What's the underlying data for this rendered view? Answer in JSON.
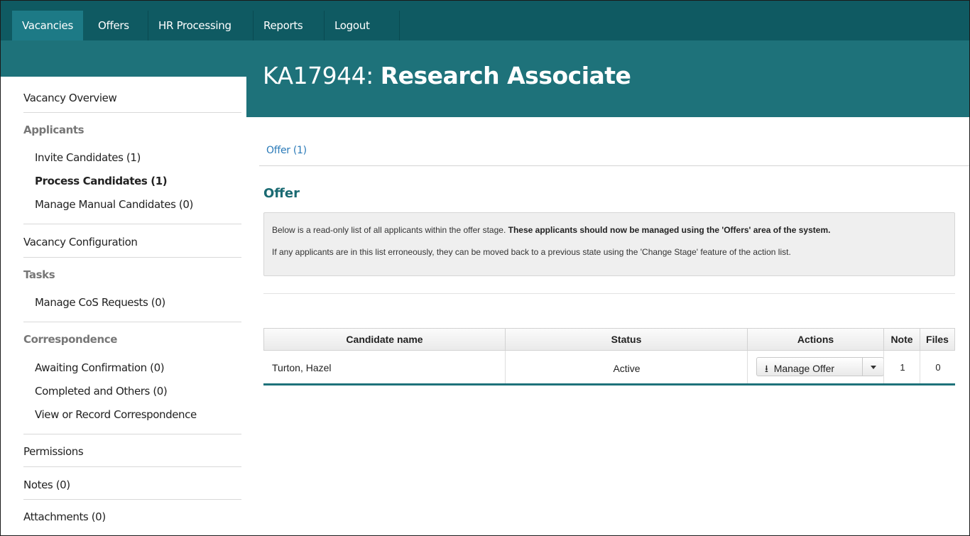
{
  "topnav": {
    "items": [
      {
        "label": "Vacancies",
        "active": true
      },
      {
        "label": "Offers",
        "active": false
      },
      {
        "label": "HR Processing",
        "active": false
      },
      {
        "label": "Reports",
        "active": false
      },
      {
        "label": "Logout",
        "active": false
      }
    ]
  },
  "header": {
    "code": "KA17944:",
    "name": "Research Associate"
  },
  "sidebar": {
    "vacancy_overview": "Vacancy Overview",
    "applicants_heading": "Applicants",
    "invite_candidates": "Invite Candidates (1)",
    "process_candidates": "Process Candidates (1)",
    "manage_manual_candidates": "Manage Manual Candidates (0)",
    "vacancy_configuration": "Vacancy Configuration",
    "tasks_heading": "Tasks",
    "manage_cos_requests": "Manage CoS Requests (0)",
    "correspondence_heading": "Correspondence",
    "awaiting_confirmation": "Awaiting Confirmation (0)",
    "completed_and_others": "Completed and Others (0)",
    "view_or_record": "View or Record Correspondence",
    "permissions": "Permissions",
    "notes": "Notes (0)",
    "attachments": "Attachments (0)"
  },
  "main": {
    "tab_label": "Offer (1)",
    "section_title": "Offer",
    "info_line1_plain": "Below is a read-only list of all applicants within the offer stage.",
    "info_line1_bold": "These applicants should now be managed using the 'Offers' area of the system.",
    "info_line2": "If any applicants are in this list erroneously, they can be moved back to a previous state using the 'Change Stage' feature of the action list."
  },
  "table": {
    "headers": {
      "candidate_name": "Candidate name",
      "status": "Status",
      "actions": "Actions",
      "note": "Note",
      "files": "Files"
    },
    "rows": [
      {
        "candidate_name": "Turton, Hazel",
        "status": "Active",
        "action_label": "Manage Offer",
        "note": "1",
        "files": "0"
      }
    ]
  },
  "colors": {
    "nav_bg": "#0f5a62",
    "nav_active": "#1d7a86",
    "band": "#1e727a",
    "link": "#2a7ab8"
  }
}
